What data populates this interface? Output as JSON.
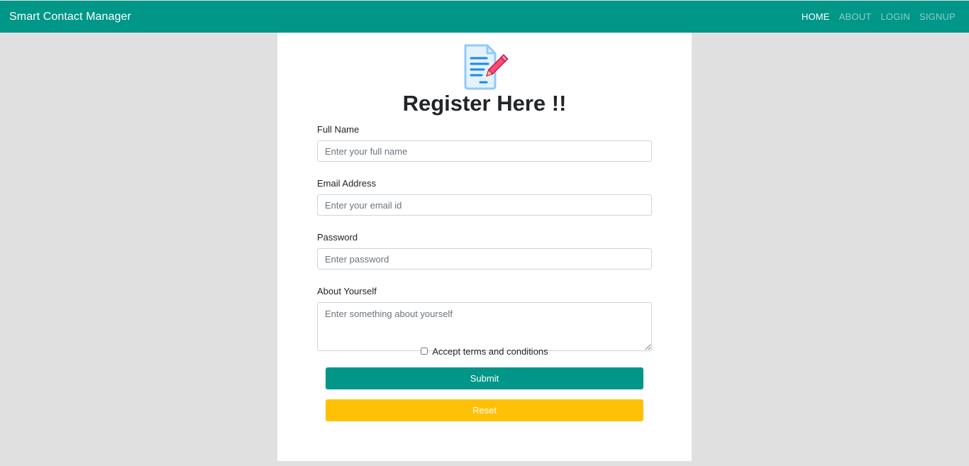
{
  "navbar": {
    "brand": "Smart Contact Manager",
    "links": [
      "HOME",
      "ABOUT",
      "LOGIN",
      "SIGNUP"
    ],
    "active": "HOME",
    "bg_color": "#009688"
  },
  "card": {
    "logo_icon": "document-pencil-icon",
    "title": "Register Here !!"
  },
  "form": {
    "name": {
      "label": "Full Name",
      "placeholder": "Enter your full name",
      "value": ""
    },
    "email": {
      "label": "Email Address",
      "placeholder": "Enter your email id",
      "value": ""
    },
    "password": {
      "label": "Password",
      "placeholder": "Enter password",
      "value": ""
    },
    "about": {
      "label": "About Yourself",
      "placeholder": "Enter something about yourself",
      "value": ""
    },
    "terms_label": "Accept terms and conditions",
    "terms_checked": false,
    "submit_label": "Submit",
    "reset_label": "Reset"
  },
  "colors": {
    "primary": "#009688",
    "warning": "#ffc107",
    "background": "#e0e0e0"
  }
}
